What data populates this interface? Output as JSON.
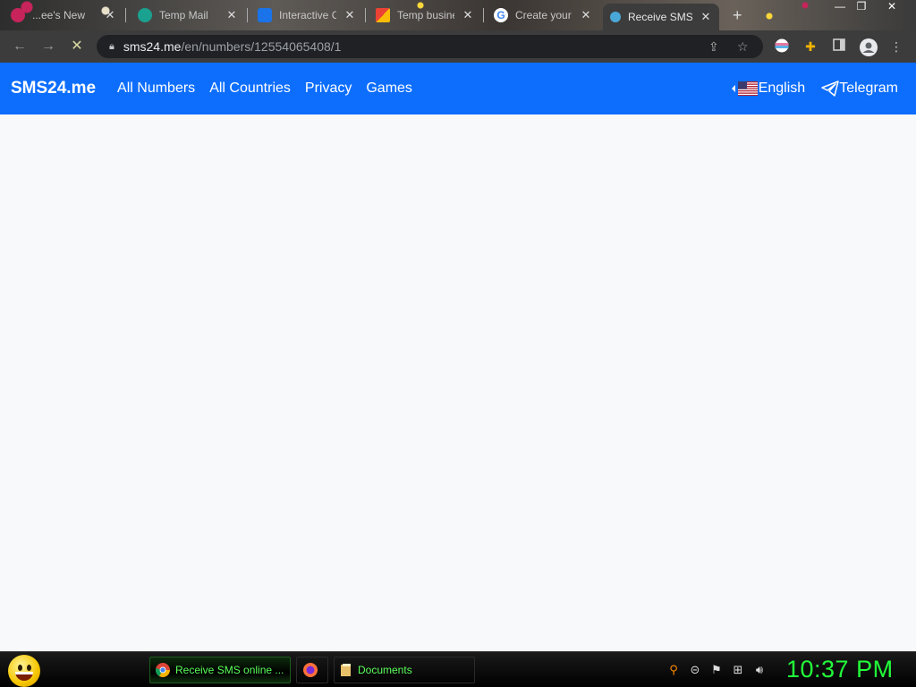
{
  "browser": {
    "tabs": [
      {
        "title": "...ee's New",
        "favicon": "red-favicon"
      },
      {
        "title": "Temp Mail",
        "favicon": "tempmail-favicon"
      },
      {
        "title": "Interactive C",
        "favicon": "play-favicon"
      },
      {
        "title": "Temp busine",
        "favicon": "gmail-favicon"
      },
      {
        "title": "Create your",
        "favicon": "google-favicon"
      },
      {
        "title": "Receive SMS",
        "favicon": "sms24-favicon",
        "active": true
      }
    ],
    "new_tab": "+",
    "address": {
      "host": "sms24.me",
      "path": "/en/numbers/12554065408/1"
    }
  },
  "site": {
    "brand": "SMS24.me",
    "nav": [
      "All Numbers",
      "All Countries",
      "Privacy",
      "Games"
    ],
    "language": "English",
    "telegram": "Telegram",
    "colors": {
      "navbar": "#0d6efd",
      "body": "#f8f9fa"
    }
  },
  "taskbar": {
    "tasks": [
      {
        "label": "Receive SMS online ...",
        "icon": "chrome-icon",
        "active": true
      },
      {
        "label": "",
        "icon": "firefox-icon"
      },
      {
        "label": "Documents",
        "icon": "folder-icon"
      }
    ],
    "clock": "10:37 PM",
    "clock_color": "#22ff3a"
  }
}
